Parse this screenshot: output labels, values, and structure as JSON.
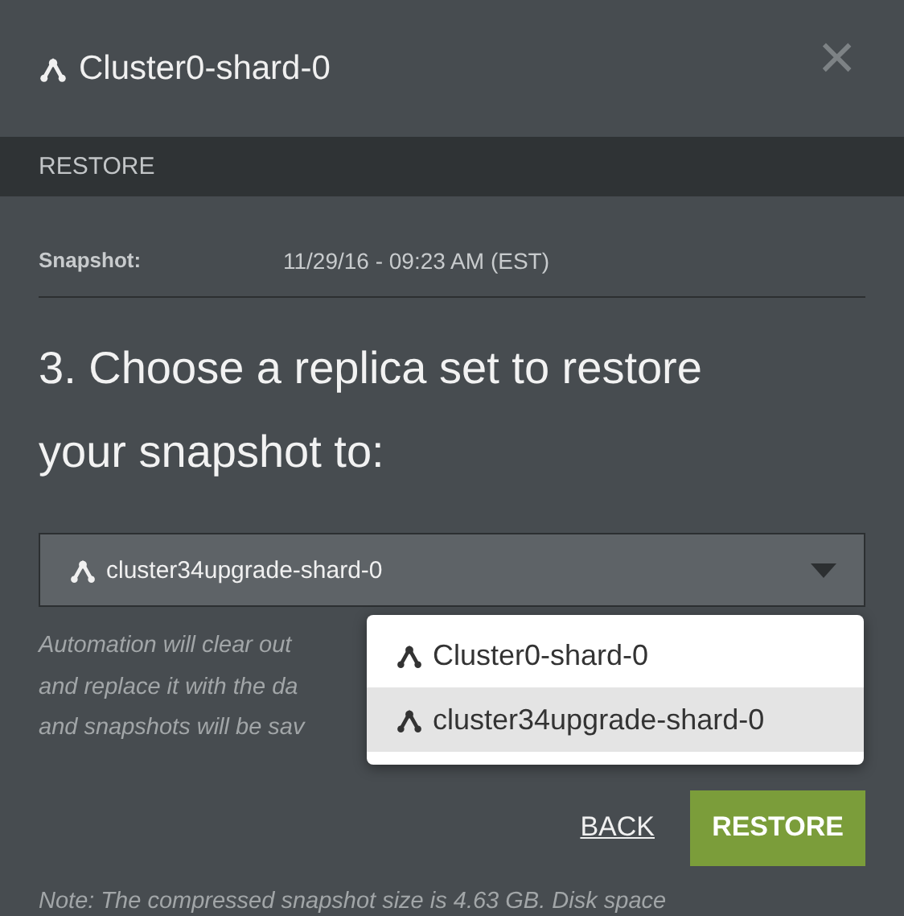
{
  "header": {
    "title": "Cluster0-shard-0",
    "close": "×"
  },
  "section": {
    "title": "RESTORE"
  },
  "snapshot": {
    "label": "Snapshot:",
    "value": "11/29/16 - 09:23 AM (EST)"
  },
  "heading": "3. Choose a replica set to restore your snapshot to:",
  "select": {
    "value": "cluster34upgrade-shard-0",
    "expanded": true,
    "options": [
      {
        "label": "Cluster0-shard-0",
        "selected": false
      },
      {
        "label": "cluster34upgrade-shard-0",
        "selected": true
      }
    ]
  },
  "help_lines": [
    "Automation will clear out",
    "and replace it with the da",
    "and snapshots will be sav"
  ],
  "buttons": {
    "back": "BACK",
    "restore": "RESTORE"
  },
  "note": "Note: The compressed snapshot size is 4.63 GB. Disk space"
}
